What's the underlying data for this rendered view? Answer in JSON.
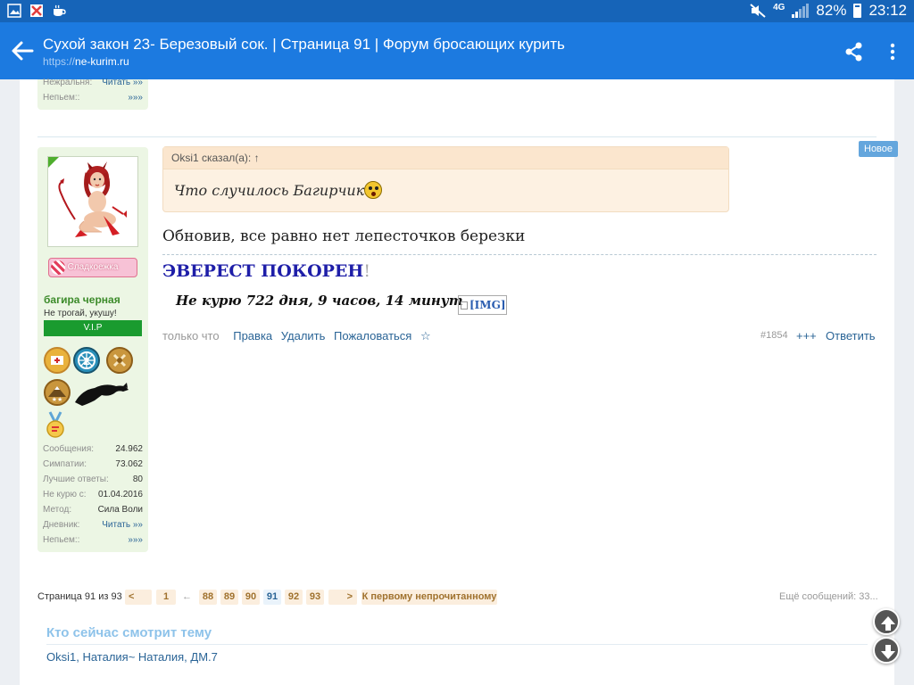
{
  "status_bar": {
    "network": "4G",
    "battery": "82%",
    "time": "23:12"
  },
  "app_bar": {
    "title": "Сухой закон 23- Березовый сок. | Страница 91 | Форум бросающих курить",
    "url_scheme": "https://",
    "url_host": "ne-kurim.ru"
  },
  "prev_post_stats": [
    {
      "label": "Нежральня:",
      "value": "Читать »»"
    },
    {
      "label": "Непьем::",
      "value": "»»»"
    }
  ],
  "new_badge": "Новое",
  "user": {
    "candy_label": "Сладкоежка",
    "name": "багира черная",
    "title": "Не трогай, укушу!",
    "rank": "V.I.P",
    "stats": [
      {
        "label": "Сообщения:",
        "value": "24.962"
      },
      {
        "label": "Симпатии:",
        "value": "73.062"
      },
      {
        "label": "Лучшие ответы:",
        "value": "80"
      },
      {
        "label": "Не курю с:",
        "value": "01.04.2016"
      },
      {
        "label": "Метод:",
        "value": "Сила Воли"
      },
      {
        "label": "Дневник:",
        "value": "Читать »»"
      },
      {
        "label": "Непьем::",
        "value": "»»»"
      }
    ]
  },
  "post": {
    "quote_author": "Oksi1 сказал(а): ↑",
    "quote_text": "Что случилось Багирчик",
    "text": "Обновив, все равно нет лепесточков березки",
    "signature_title": "ЭВЕРЕСТ ПОКОРЕН",
    "signature_excl": "!",
    "counter_text": "Не курю  722 дня, 9 часов, 14 минут",
    "img_placeholder": "[IMG]",
    "time": "только что",
    "actions": [
      "Правка",
      "Удалить",
      "Пожаловаться",
      "☆"
    ],
    "number": "#1854",
    "plus": "+++",
    "reply": "Ответить"
  },
  "pagination": {
    "label": "Страница 91 из 93",
    "prev": "<",
    "first": "1",
    "ellipsis": "←",
    "pages": [
      "88",
      "89",
      "90",
      "91",
      "92",
      "93"
    ],
    "current": "91",
    "next": ">",
    "first_unread": "К первому непрочитанному",
    "more_messages": "Ещё сообщений: 33..."
  },
  "viewers": {
    "title": "Кто сейчас смотрит тему",
    "list": "Oksi1, Наталия~ Наталия, ДМ.7"
  },
  "colors": {
    "status_bar": "#1664b8",
    "app_bar": "#1c7ae0",
    "sidebar_bg": "#ecf6e4",
    "username": "#3c8b2a",
    "vip": "#1a9b2f",
    "link": "#2a6496",
    "signature": "#1e1ea8",
    "new_badge": "#64a6dd"
  },
  "icons": {
    "status_left": [
      "gallery-icon",
      "flipboard-icon",
      "coffee-icon"
    ],
    "status_right": [
      "mute-icon",
      "signal-icon",
      "battery-icon"
    ],
    "app_bar": [
      "back-arrow-icon",
      "share-icon",
      "more-vert-icon"
    ],
    "fabs": [
      "scroll-up-icon",
      "scroll-down-icon"
    ]
  }
}
